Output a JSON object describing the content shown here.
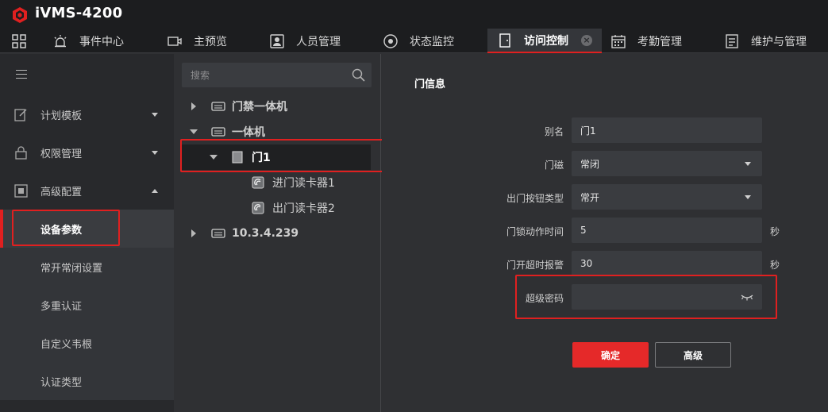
{
  "app": {
    "title": "iVMS-4200"
  },
  "tabs": [
    {
      "label": "事件中心",
      "icon": "alarm-icon"
    },
    {
      "label": "主预览",
      "icon": "camera-icon"
    },
    {
      "label": "人员管理",
      "icon": "person-card-icon"
    },
    {
      "label": "状态监控",
      "icon": "gauge-icon"
    },
    {
      "label": "访问控制",
      "icon": "door-icon",
      "active": true
    },
    {
      "label": "考勤管理",
      "icon": "calendar-icon"
    },
    {
      "label": "维护与管理",
      "icon": "maintenance-icon"
    }
  ],
  "sidebar": {
    "items": [
      {
        "label": "计划模板",
        "icon": "edit-icon",
        "expanded": false
      },
      {
        "label": "权限管理",
        "icon": "lock-icon",
        "expanded": false
      },
      {
        "label": "高级配置",
        "icon": "settings-icon",
        "expanded": true
      }
    ],
    "sub_items": [
      {
        "label": "设备参数",
        "active": true
      },
      {
        "label": "常开常闭设置"
      },
      {
        "label": "多重认证"
      },
      {
        "label": "自定义韦根"
      },
      {
        "label": "认证类型"
      }
    ]
  },
  "tree": {
    "search_placeholder": "搜索",
    "nodes": [
      {
        "label": "门禁一体机",
        "expanded": false
      },
      {
        "label": "一体机",
        "expanded": true
      },
      {
        "label": "门1",
        "expanded": true,
        "selected": true
      },
      {
        "label": "进门读卡器1"
      },
      {
        "label": "出门读卡器2"
      },
      {
        "label": "10.3.4.239",
        "expanded": false
      }
    ]
  },
  "form": {
    "title": "门信息",
    "fields": {
      "alias": {
        "label": "别名",
        "value": "门1"
      },
      "door_magnet": {
        "label": "门磁",
        "value": "常闭"
      },
      "exit_button": {
        "label": "出门按钮类型",
        "value": "常开"
      },
      "lock_time": {
        "label": "门锁动作时间",
        "value": "5",
        "unit": "秒"
      },
      "open_timeout": {
        "label": "门开超时报警",
        "value": "30",
        "unit": "秒"
      },
      "super_password": {
        "label": "超级密码",
        "value": ""
      }
    },
    "buttons": {
      "ok": "确定",
      "advanced": "高级"
    }
  },
  "colors": {
    "accent": "#e52929",
    "background": "#2f3033",
    "sidebar": "#28292c",
    "titlebar": "#1c1d1f"
  }
}
